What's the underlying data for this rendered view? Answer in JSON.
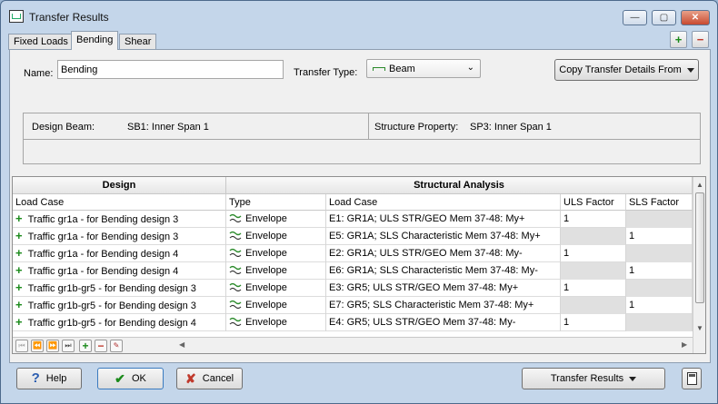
{
  "window": {
    "title": "Transfer Results"
  },
  "tabs": [
    {
      "label": "Fixed Loads"
    },
    {
      "label": "Bending"
    },
    {
      "label": "Shear"
    }
  ],
  "form": {
    "name_label": "Name:",
    "name_value": "Bending",
    "transfer_type_label": "Transfer Type:",
    "transfer_type_value": "Beam",
    "copy_button": "Copy Transfer Details From"
  },
  "info": {
    "design_beam_label": "Design Beam:",
    "design_beam_value": "SB1: Inner Span 1",
    "structure_property_label": "Structure Property:",
    "structure_property_value": "SP3: Inner Span 1"
  },
  "grid": {
    "group_design": "Design",
    "group_structural": "Structural Analysis",
    "columns": [
      "Load Case",
      "Type",
      "Load Case",
      "ULS Factor",
      "SLS Factor"
    ],
    "rows": [
      {
        "design": "Traffic gr1a - for Bending design 3",
        "type": "Envelope",
        "sa": "E1: GR1A; ULS STR/GEO Mem 37-48: My+",
        "uls": "1",
        "sls": ""
      },
      {
        "design": "Traffic gr1a - for Bending design 3",
        "type": "Envelope",
        "sa": "E5: GR1A; SLS Characteristic Mem 37-48: My+",
        "uls": "",
        "sls": "1"
      },
      {
        "design": "Traffic gr1a - for Bending design 4",
        "type": "Envelope",
        "sa": "E2: GR1A; ULS STR/GEO Mem 37-48: My-",
        "uls": "1",
        "sls": ""
      },
      {
        "design": "Traffic gr1a - for Bending design 4",
        "type": "Envelope",
        "sa": "E6: GR1A; SLS Characteristic Mem 37-48: My-",
        "uls": "",
        "sls": "1"
      },
      {
        "design": "Traffic gr1b-gr5 - for Bending design 3",
        "type": "Envelope",
        "sa": "E3: GR5; ULS STR/GEO Mem 37-48: My+",
        "uls": "1",
        "sls": ""
      },
      {
        "design": "Traffic gr1b-gr5 - for Bending design 3",
        "type": "Envelope",
        "sa": "E7: GR5; SLS Characteristic Mem 37-48: My+",
        "uls": "",
        "sls": "1"
      },
      {
        "design": "Traffic gr1b-gr5 - for Bending design 4",
        "type": "Envelope",
        "sa": "E4: GR5; ULS STR/GEO Mem 37-48: My-",
        "uls": "1",
        "sls": ""
      }
    ]
  },
  "footer": {
    "help": "Help",
    "ok": "OK",
    "cancel": "Cancel",
    "transfer_results": "Transfer Results"
  },
  "colors": {
    "add_green": "#1b8a1b",
    "remove_red": "#c0392b",
    "ok_border": "#3b7bbf"
  }
}
